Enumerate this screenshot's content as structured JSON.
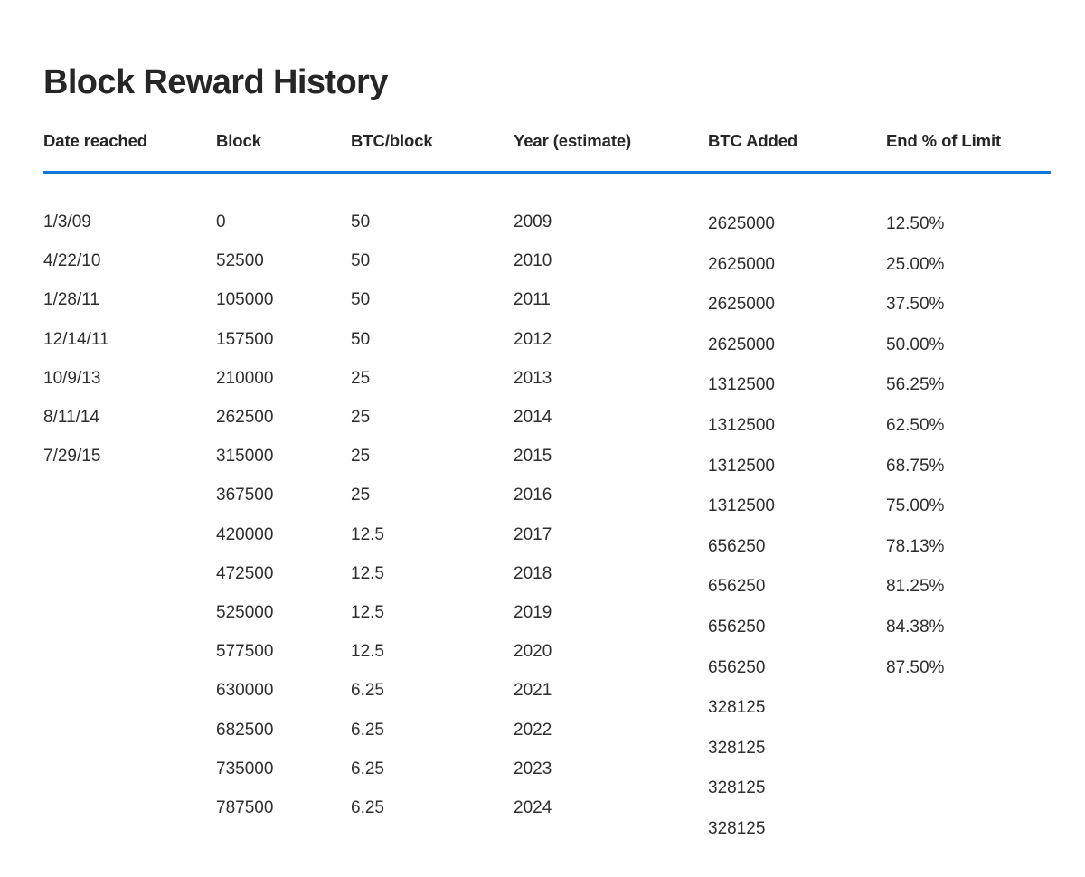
{
  "title": "Block Reward History",
  "accent_color": "#1277d8",
  "text_color": "#2e2e2e",
  "title_color": "#262626",
  "background_color": "#ffffff",
  "table": {
    "columns": [
      "Date reached",
      "Block",
      "BTC/block",
      "Year (estimate)",
      "BTC Added",
      "End % of Limit"
    ],
    "rows": [
      {
        "date": "1/3/09",
        "block": "0",
        "btc_per_block": "50",
        "year": "2009",
        "btc_added": "2625000",
        "end_pct": "12.50%"
      },
      {
        "date": "4/22/10",
        "block": "52500",
        "btc_per_block": "50",
        "year": "2010",
        "btc_added": "2625000",
        "end_pct": "25.00%"
      },
      {
        "date": "1/28/11",
        "block": "105000",
        "btc_per_block": "50",
        "year": "2011",
        "btc_added": "2625000",
        "end_pct": "37.50%"
      },
      {
        "date": "12/14/11",
        "block": "157500",
        "btc_per_block": "50",
        "year": "2012",
        "btc_added": "2625000",
        "end_pct": "50.00%"
      },
      {
        "date": "10/9/13",
        "block": "210000",
        "btc_per_block": "25",
        "year": "2013",
        "btc_added": "1312500",
        "end_pct": "56.25%"
      },
      {
        "date": "8/11/14",
        "block": "262500",
        "btc_per_block": "25",
        "year": "2014",
        "btc_added": "1312500",
        "end_pct": "62.50%"
      },
      {
        "date": "7/29/15",
        "block": "315000",
        "btc_per_block": "25",
        "year": "2015",
        "btc_added": "1312500",
        "end_pct": "68.75%"
      },
      {
        "date": "",
        "block": "367500",
        "btc_per_block": "25",
        "year": "2016",
        "btc_added": "1312500",
        "end_pct": "75.00%"
      },
      {
        "date": "",
        "block": "420000",
        "btc_per_block": "12.5",
        "year": "2017",
        "btc_added": "656250",
        "end_pct": "78.13%"
      },
      {
        "date": "",
        "block": "472500",
        "btc_per_block": "12.5",
        "year": "2018",
        "btc_added": "656250",
        "end_pct": "81.25%"
      },
      {
        "date": "",
        "block": "525000",
        "btc_per_block": "12.5",
        "year": "2019",
        "btc_added": "656250",
        "end_pct": "84.38%"
      },
      {
        "date": "",
        "block": "577500",
        "btc_per_block": "12.5",
        "year": "2020",
        "btc_added": "656250",
        "end_pct": "87.50%"
      },
      {
        "date": "",
        "block": "630000",
        "btc_per_block": "6.25",
        "year": "2021",
        "btc_added": "328125",
        "end_pct": ""
      },
      {
        "date": "",
        "block": "682500",
        "btc_per_block": "6.25",
        "year": "2022",
        "btc_added": "328125",
        "end_pct": ""
      },
      {
        "date": "",
        "block": "735000",
        "btc_per_block": "6.25",
        "year": "2023",
        "btc_added": "328125",
        "end_pct": ""
      },
      {
        "date": "",
        "block": "787500",
        "btc_per_block": "6.25",
        "year": "2024",
        "btc_added": "328125",
        "end_pct": ""
      }
    ]
  },
  "chart_data": {
    "type": "table",
    "title": "Block Reward History",
    "columns": [
      "Date reached",
      "Block",
      "BTC/block",
      "Year (estimate)",
      "BTC Added",
      "End % of Limit"
    ],
    "rows": [
      [
        "1/3/09",
        "0",
        "50",
        "2009",
        "2625000",
        "12.50%"
      ],
      [
        "4/22/10",
        "52500",
        "50",
        "2010",
        "2625000",
        "25.00%"
      ],
      [
        "1/28/11",
        "105000",
        "50",
        "2011",
        "2625000",
        "37.50%"
      ],
      [
        "12/14/11",
        "157500",
        "50",
        "2012",
        "2625000",
        "50.00%"
      ],
      [
        "10/9/13",
        "210000",
        "25",
        "2013",
        "1312500",
        "56.25%"
      ],
      [
        "8/11/14",
        "262500",
        "25",
        "2014",
        "1312500",
        "62.50%"
      ],
      [
        "7/29/15",
        "315000",
        "25",
        "2015",
        "1312500",
        "68.75%"
      ],
      [
        "",
        "367500",
        "25",
        "2016",
        "1312500",
        "75.00%"
      ],
      [
        "",
        "420000",
        "12.5",
        "2017",
        "656250",
        "78.13%"
      ],
      [
        "",
        "472500",
        "12.5",
        "2018",
        "656250",
        "81.25%"
      ],
      [
        "",
        "525000",
        "12.5",
        "2019",
        "656250",
        "84.38%"
      ],
      [
        "",
        "577500",
        "12.5",
        "2020",
        "656250",
        "87.50%"
      ],
      [
        "",
        "630000",
        "6.25",
        "2021",
        "328125",
        ""
      ],
      [
        "",
        "682500",
        "6.25",
        "2022",
        "328125",
        ""
      ],
      [
        "",
        "735000",
        "6.25",
        "2023",
        "328125",
        ""
      ],
      [
        "",
        "787500",
        "6.25",
        "2024",
        "328125",
        ""
      ]
    ]
  }
}
